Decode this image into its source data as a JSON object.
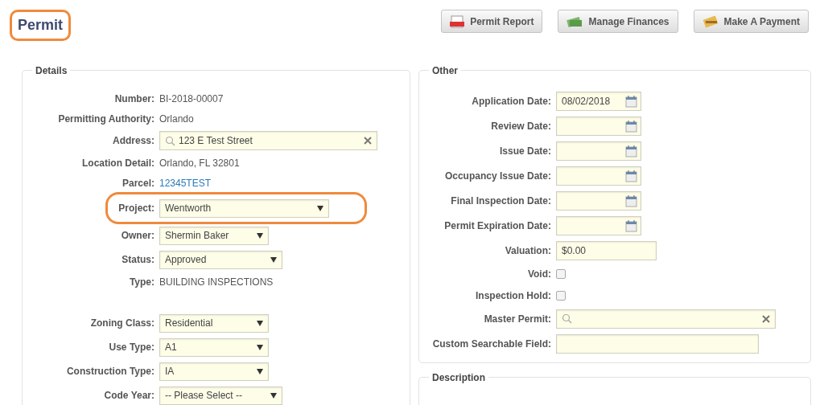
{
  "page": {
    "title": "Permit",
    "highlighted": true
  },
  "actions": [
    {
      "label": "Permit Report",
      "kind": "pdf"
    },
    {
      "label": "Manage Finances",
      "kind": "money"
    },
    {
      "label": "Make A Payment",
      "kind": "card"
    }
  ],
  "details": {
    "legend": "Details",
    "groups": [
      [
        {
          "label": "Number:",
          "kind": "text",
          "value": "BI-2018-00007"
        },
        {
          "label": "Permitting Authority:",
          "kind": "text",
          "value": "Orlando"
        },
        {
          "label": "Address:",
          "kind": "search",
          "value": "123 E Test Street"
        },
        {
          "label": "Location Detail:",
          "kind": "text",
          "value": "Orlando, FL 32801"
        },
        {
          "label": "Parcel:",
          "kind": "link",
          "value": "12345TEST"
        },
        {
          "label": "Project:",
          "kind": "select",
          "value": "Wentworth",
          "highlighted": true
        },
        {
          "label": "Owner:",
          "kind": "select",
          "value": "Shermin Baker"
        },
        {
          "label": "Status:",
          "kind": "select",
          "value": "Approved"
        },
        {
          "label": "Type:",
          "kind": "text",
          "value": "BUILDING INSPECTIONS"
        }
      ],
      [
        {
          "label": "Zoning Class:",
          "kind": "select",
          "value": "Residential"
        },
        {
          "label": "Use Type:",
          "kind": "select",
          "value": "A1"
        },
        {
          "label": "Construction Type:",
          "kind": "select",
          "value": "IA"
        },
        {
          "label": "Code Year:",
          "kind": "select",
          "value": "-- Please Select --"
        }
      ]
    ]
  },
  "other": {
    "legend": "Other",
    "fields": [
      {
        "label": "Application Date:",
        "kind": "date",
        "value": "08/02/2018"
      },
      {
        "label": "Review Date:",
        "kind": "date"
      },
      {
        "label": "Issue Date:",
        "kind": "date"
      },
      {
        "label": "Occupancy Issue Date:",
        "kind": "date"
      },
      {
        "label": "Final Inspection Date:",
        "kind": "date"
      },
      {
        "label": "Permit Expiration Date:",
        "kind": "date"
      },
      {
        "label": "Valuation:",
        "kind": "input",
        "value": "$0.00"
      },
      {
        "label": "Void:",
        "kind": "checkbox",
        "checked": false
      },
      {
        "label": "Inspection Hold:",
        "kind": "checkbox",
        "checked": false
      },
      {
        "label": "Master Permit:",
        "kind": "search"
      },
      {
        "label": "Custom Searchable Field:",
        "kind": "wideinput"
      }
    ]
  },
  "description": {
    "legend": "Description"
  }
}
